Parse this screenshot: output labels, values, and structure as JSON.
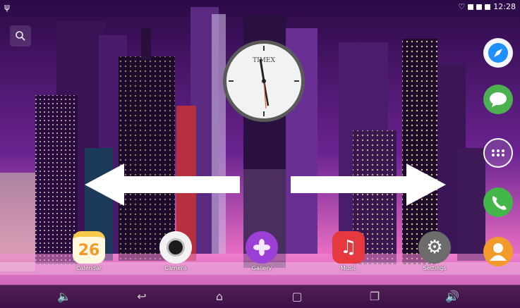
{
  "status_bar": {
    "time": "12:28",
    "usb_icon": "usb-icon",
    "signal_icons": [
      "notification-icon",
      "signal-icon",
      "battery-icon"
    ]
  },
  "clock": {
    "brand": "TIMEX"
  },
  "calendar": {
    "date": "26"
  },
  "apps": [
    {
      "name": "calendar",
      "label": "Calendar",
      "icon": "calendar-icon",
      "color": "#f7c94a"
    },
    {
      "name": "camera",
      "label": "Camera",
      "icon": "camera-icon",
      "color": "#ffffff"
    },
    {
      "name": "gallery",
      "label": "Gallery",
      "icon": "gallery-icon",
      "color": "#9b3fd6"
    },
    {
      "name": "music",
      "label": "Music",
      "icon": "music-icon",
      "color": "#e5383f"
    },
    {
      "name": "settings",
      "label": "Settings",
      "icon": "gear-icon",
      "color": "#6c6c6c"
    }
  ],
  "right_dock": [
    {
      "name": "browser",
      "icon": "compass-icon",
      "color": "#1e8fff"
    },
    {
      "name": "messaging",
      "icon": "chat-icon",
      "color": "#4caf50"
    },
    {
      "name": "app-drawer",
      "icon": "grid-icon",
      "color": "#ffffff"
    },
    {
      "name": "phone",
      "icon": "phone-icon",
      "color": "#43b649"
    },
    {
      "name": "contacts",
      "icon": "contact-icon",
      "color": "#f39a2a"
    }
  ],
  "nav_bar": [
    "volume-down-icon",
    "back-icon",
    "home-icon",
    "screenshot-icon",
    "recents-icon",
    "volume-up-icon"
  ]
}
